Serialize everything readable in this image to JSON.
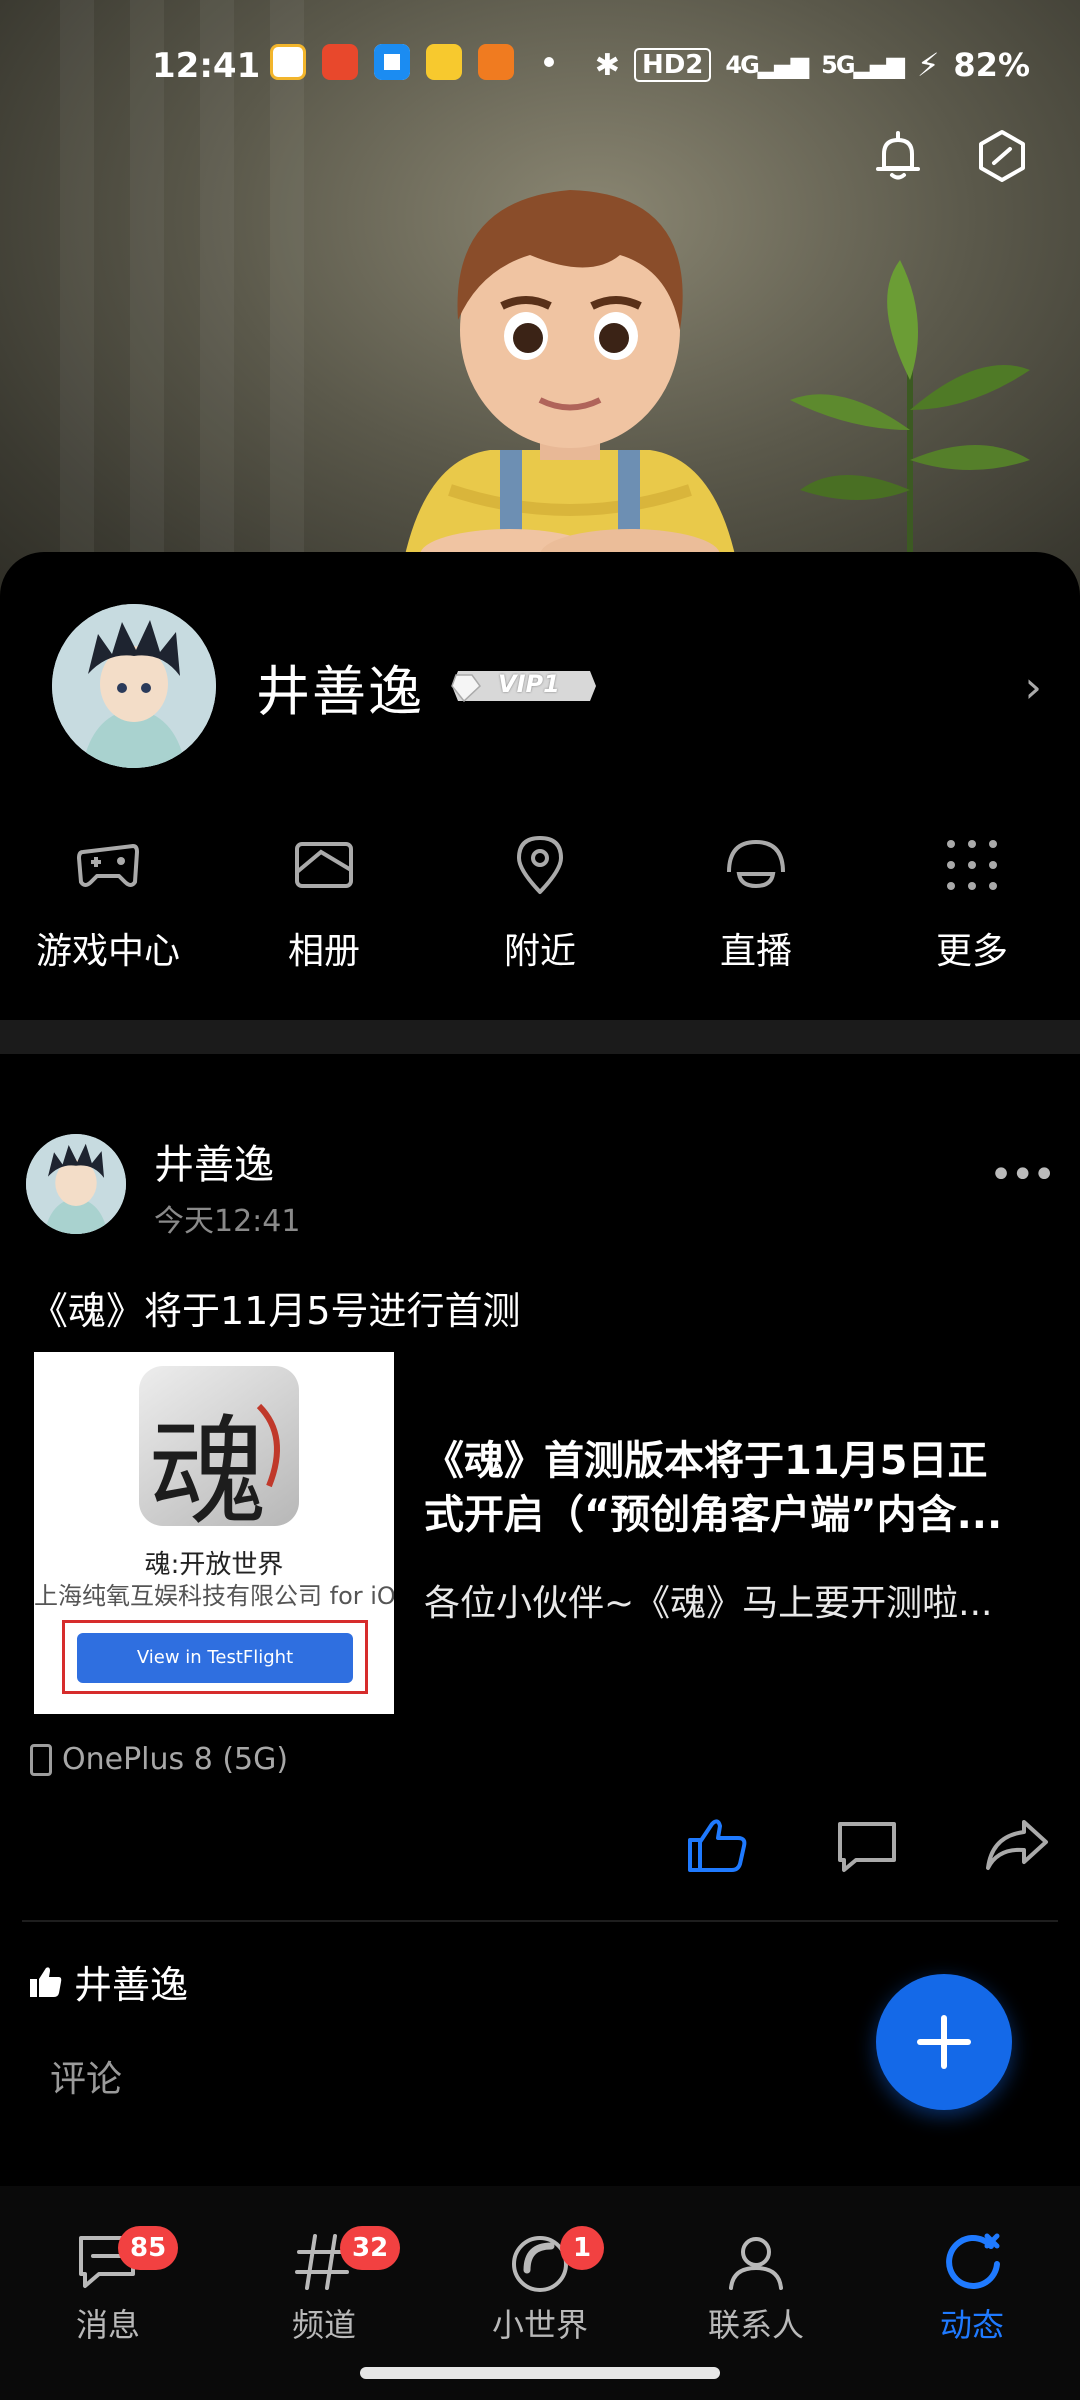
{
  "status_bar": {
    "time": "12:41",
    "network_hd": "HD2",
    "network_4g": "4G",
    "network_5g": "5G",
    "battery": "82%"
  },
  "profile": {
    "name": "井善逸",
    "vip_label": "VIP1"
  },
  "quick_actions": [
    {
      "label": "游戏中心",
      "icon": "gamepad-icon"
    },
    {
      "label": "相册",
      "icon": "album-icon"
    },
    {
      "label": "附近",
      "icon": "location-pin-icon"
    },
    {
      "label": "直播",
      "icon": "live-icon"
    },
    {
      "label": "更多",
      "icon": "grid-dots-icon"
    }
  ],
  "post": {
    "author": "井善逸",
    "time": "今天12:41",
    "text": "《魂》将于11月5号进行首测",
    "share": {
      "thumb_title": "魂:开放世界",
      "thumb_company": "上海纯氧互娱科技有限公司 for iOS",
      "thumb_button": "View in TestFlight",
      "title_line1": "《魂》首测版本将于11月5日正",
      "title_line2": "式开启（“预创角客户端”内含...",
      "desc": "各位小伙伴~《魂》马上要开测啦..."
    },
    "device": "OnePlus 8 (5G)",
    "likes_name": "井善逸",
    "comment_placeholder": "评论"
  },
  "bottom_nav": [
    {
      "label": "消息",
      "badge": "85",
      "icon": "message-icon"
    },
    {
      "label": "频道",
      "badge": "32",
      "icon": "channel-icon"
    },
    {
      "label": "小世界",
      "badge": "1",
      "icon": "small-world-icon"
    },
    {
      "label": "联系人",
      "badge": "",
      "icon": "contacts-icon"
    },
    {
      "label": "动态",
      "badge": "",
      "icon": "feed-icon",
      "active": true
    }
  ],
  "colors": {
    "accent": "#1469e8",
    "badge": "#f24141",
    "active_nav": "#1f7aff"
  }
}
